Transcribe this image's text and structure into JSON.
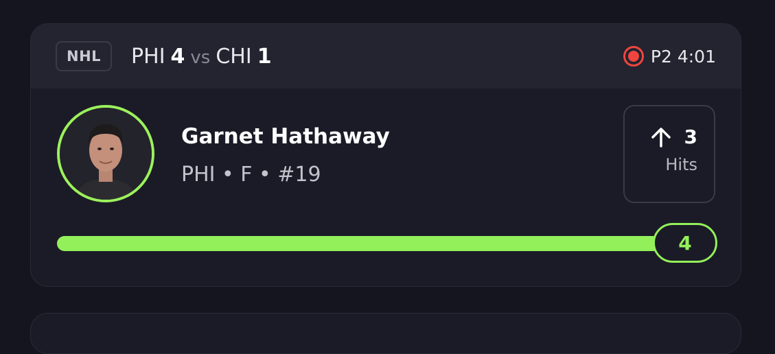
{
  "game": {
    "league": "NHL",
    "home_team": "PHI",
    "home_score": "4",
    "vs_label": "vs",
    "away_team": "CHI",
    "away_score": "1",
    "status": "P2 4:01"
  },
  "player": {
    "name": "Garnet Hathaway",
    "meta": "PHI • F • #19"
  },
  "stat": {
    "direction_icon": "arrow-up-icon",
    "value": "3",
    "label": "Hits"
  },
  "progress": {
    "current": "4",
    "fraction": 1.0
  },
  "colors": {
    "accent": "#93f05a",
    "live": "#f0453f",
    "card": "#1b1b27",
    "header": "#242430"
  }
}
